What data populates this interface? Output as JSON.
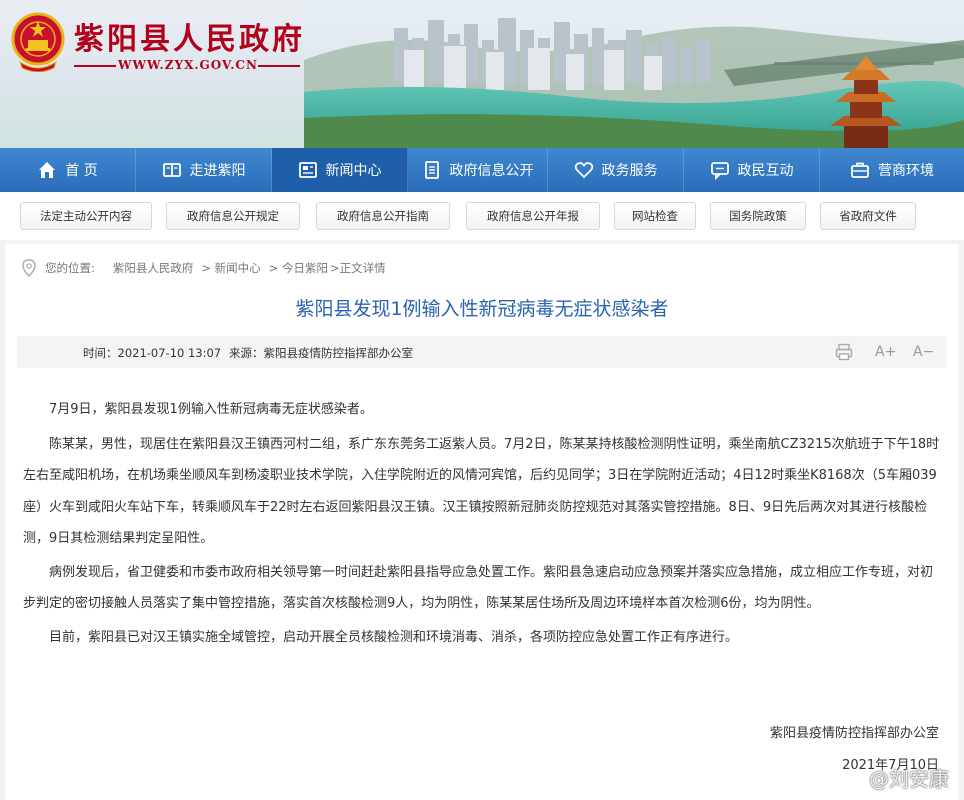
{
  "header": {
    "site_title": "紫阳县人民政府",
    "site_url": "WWW.ZYX.GOV.CN",
    "emblem_icon": "national-emblem-icon",
    "brand_color": "#b3001b"
  },
  "nav": {
    "items": [
      {
        "label": "首 页",
        "icon": "home-icon"
      },
      {
        "label": "走进紫阳",
        "icon": "book-icon"
      },
      {
        "label": "新闻中心",
        "icon": "news-icon",
        "active": true
      },
      {
        "label": "政府信息公开",
        "icon": "document-list-icon"
      },
      {
        "label": "政务服务",
        "icon": "heart-service-icon"
      },
      {
        "label": "政民互动",
        "icon": "chat-icon"
      },
      {
        "label": "营商环境",
        "icon": "briefcase-icon"
      }
    ],
    "bar_color": "#2a6db8"
  },
  "quick_links": [
    "法定主动公开内容",
    "政府信息公开规定",
    "政府信息公开指南",
    "政府信息公开年报",
    "网站检查",
    "国务院政策",
    "省政府文件"
  ],
  "breadcrumb": {
    "prefix": "您的位置:",
    "items": [
      "紫阳县人民政府",
      "> 新闻中心",
      "> 今日紫阳",
      ">正文详情"
    ]
  },
  "article": {
    "title": "紫阳县发现1例输入性新冠病毒无症状感染者",
    "time": "时间：2021-07-10 13:07",
    "source": "来源：紫阳县疫情防控指挥部办公室",
    "tools": {
      "font_increase": "A+",
      "font_decrease": "A−",
      "print_icon": "print-icon"
    },
    "paragraphs": [
      "7月9日，紫阳县发现1例输入性新冠病毒无症状感染者。",
      "陈某某，男性，现居住在紫阳县汉王镇西河村二组，系广东东莞务工返紫人员。7月2日，陈某某持核酸检测阴性证明，乘坐南航CZ3215次航班于下午18时左右至咸阳机场，在机场乘坐顺风车到杨凌职业技术学院，入住学院附近的风情河宾馆，后约见同学；3日在学院附近活动；4日12时乘坐K8168次（5车厢039座）火车到咸阳火车站下车，转乘顺风车于22时左右返回紫阳县汉王镇。汉王镇按照新冠肺炎防控规范对其落实管控措施。8日、9日先后两次对其进行核酸检测，9日其检测结果判定呈阳性。",
      "病例发现后，省卫健委和市委市政府相关领导第一时间赶赴紫阳县指导应急处置工作。紫阳县急速启动应急预案并落实应急措施，成立相应工作专班，对初步判定的密切接触人员落实了集中管控措施，落实首次核酸检测9人，均为阴性，陈某某居住场所及周边环境样本首次检测6份，均为阴性。",
      "目前，紫阳县已对汉王镇实施全域管控，启动开展全员核酸检测和环境消毒、消杀，各项防控应急处置工作正有序进行。"
    ],
    "signature_org": "紫阳县疫情防控指挥部办公室",
    "signature_date": "2021年7月10日",
    "title_color": "#2b63b0"
  },
  "watermark": {
    "text": "@刘安康",
    "icon": "weibo-icon"
  }
}
